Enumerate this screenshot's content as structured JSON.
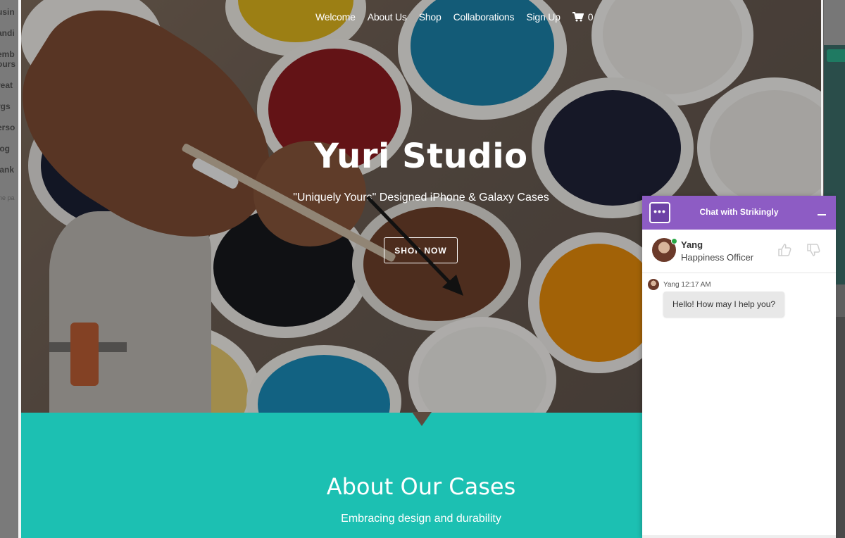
{
  "sidebar_bg": {
    "items": [
      "usin",
      "andi",
      "emb",
      "ours",
      "reat",
      "rgs ",
      "erso",
      "log",
      "lank"
    ],
    "note": "ne pa"
  },
  "nav": {
    "links": [
      "Welcome",
      "About Us",
      "Shop",
      "Collaborations",
      "Sign Up"
    ],
    "cart_count": "0",
    "cart_icon": "cart-icon"
  },
  "hero": {
    "title": "Yuri Studio",
    "subtitle": "\"Uniquely Yours\" Designed iPhone & Galaxy Cases",
    "button_label": "SHOP NOW"
  },
  "about": {
    "heading": "About Our Cases",
    "tagline": "Embracing design and durability"
  },
  "chat": {
    "header_title": "Chat with Strikingly",
    "agent_name": "Yang",
    "agent_role": "Happiness Officer",
    "message_meta": "Yang 12:17 AM",
    "message_text": "Hello! How may I help you?",
    "accent_color": "#8d5cc4"
  },
  "colors": {
    "teal": "#1cc0b2",
    "chat_purple": "#8d5cc4"
  }
}
